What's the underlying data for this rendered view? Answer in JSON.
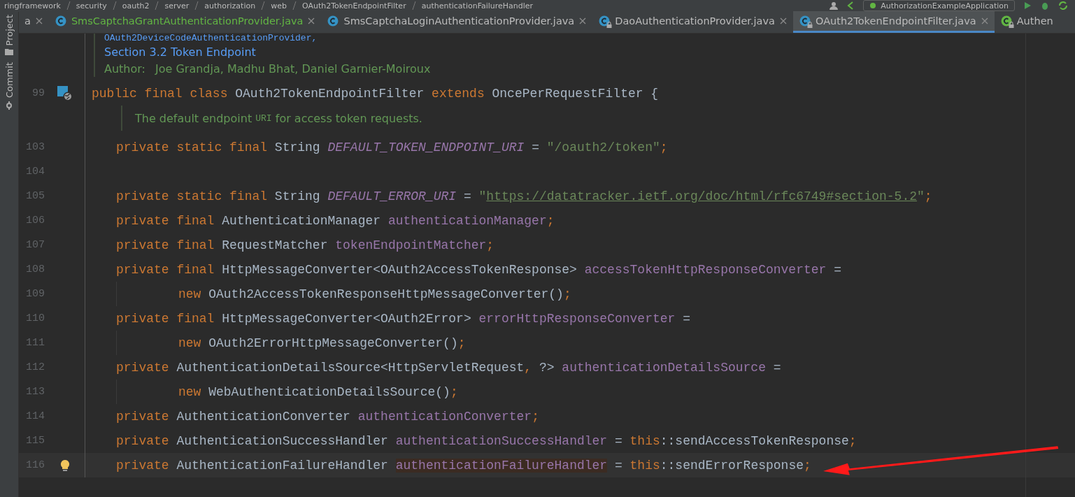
{
  "breadcrumb": [
    "ringframework",
    "security",
    "oauth2",
    "server",
    "authorization",
    "web",
    "OAuth2TokenEndpointFilter",
    "authenticationFailureHandler"
  ],
  "run_config": "AuthorizationExampleApplication",
  "tool_strip": [
    {
      "label": "Project"
    },
    {
      "label": "Commit"
    }
  ],
  "tabs": [
    {
      "kind": "partial",
      "label": "a",
      "modified": false,
      "locked": false,
      "selected": false
    },
    {
      "kind": "class",
      "label": "SmsCaptchaGrantAuthenticationProvider.java",
      "modified": true,
      "locked": false,
      "selected": false
    },
    {
      "kind": "class",
      "label": "SmsCaptchaLoginAuthenticationProvider.java",
      "modified": false,
      "locked": false,
      "selected": false
    },
    {
      "kind": "class",
      "label": "DaoAuthenticationProvider.java",
      "modified": false,
      "locked": true,
      "selected": false
    },
    {
      "kind": "class",
      "label": "OAuth2TokenEndpointFilter.java",
      "modified": false,
      "locked": true,
      "selected": true
    },
    {
      "kind": "interface",
      "label": "Authen",
      "modified": false,
      "locked": true,
      "selected": false
    }
  ],
  "editor": {
    "header_doc": [
      [
        {
          "kind": "code",
          "text": "OAuth2DeviceCodeAuthenticationProvider,"
        }
      ],
      [
        {
          "kind": "link",
          "text": "Section 3.2 Token Endpoint"
        }
      ],
      [
        {
          "kind": "label",
          "text": "Author:"
        },
        {
          "kind": "text",
          "text": "Joe Grandja, Madhu Bhat, Daniel Garnier-Moiroux"
        }
      ]
    ],
    "class_line": {
      "number": "99",
      "tokens": [
        {
          "kind": "kw",
          "text": "public final class "
        },
        {
          "kind": "type",
          "text": "OAuth2TokenEndpointFilter "
        },
        {
          "kind": "kw",
          "text": "extends "
        },
        {
          "kind": "type",
          "text": "OncePerRequestFilter {"
        }
      ]
    },
    "member_doc": [
      [
        {
          "kind": "text",
          "text": "The default endpoint "
        },
        {
          "kind": "code",
          "text": "URI"
        },
        {
          "kind": "text",
          "text": " for access token requests."
        }
      ]
    ],
    "members": [
      {
        "number": "103",
        "current": false,
        "continuation": false,
        "tokens": [
          {
            "kind": "kw",
            "text": "private static final "
          },
          {
            "kind": "type",
            "text": "String "
          },
          {
            "kind": "static",
            "text": "DEFAULT_TOKEN_ENDPOINT_URI"
          },
          {
            "kind": "type",
            "text": " = "
          },
          {
            "kind": "str",
            "text": "\"/oauth2/token\""
          },
          {
            "kind": "kw",
            "text": ";"
          }
        ]
      },
      {
        "number": "104",
        "current": false,
        "continuation": false
      },
      {
        "number": "105",
        "current": false,
        "continuation": false,
        "tokens": [
          {
            "kind": "kw",
            "text": "private static final "
          },
          {
            "kind": "type",
            "text": "String "
          },
          {
            "kind": "static",
            "text": "DEFAULT_ERROR_URI"
          },
          {
            "kind": "type",
            "text": " = "
          },
          {
            "kind": "str",
            "text": "\""
          },
          {
            "kind": "url",
            "text": "https://datatracker.ietf.org/doc/html/rfc6749#section-5.2"
          },
          {
            "kind": "str",
            "text": "\""
          },
          {
            "kind": "kw",
            "text": ";"
          }
        ]
      },
      {
        "number": "106",
        "current": false,
        "continuation": false,
        "tokens": [
          {
            "kind": "kw",
            "text": "private final "
          },
          {
            "kind": "type",
            "text": "AuthenticationManager "
          },
          {
            "kind": "field",
            "text": "authenticationManager"
          },
          {
            "kind": "kw",
            "text": ";"
          }
        ]
      },
      {
        "number": "107",
        "current": false,
        "continuation": false,
        "tokens": [
          {
            "kind": "kw",
            "text": "private final "
          },
          {
            "kind": "type",
            "text": "RequestMatcher "
          },
          {
            "kind": "field",
            "text": "tokenEndpointMatcher"
          },
          {
            "kind": "kw",
            "text": ";"
          }
        ]
      },
      {
        "number": "108",
        "current": false,
        "continuation": false,
        "tokens": [
          {
            "kind": "kw",
            "text": "private final "
          },
          {
            "kind": "type",
            "text": "HttpMessageConverter<OAuth2AccessTokenResponse> "
          },
          {
            "kind": "field",
            "text": "accessTokenHttpResponseConverter"
          },
          {
            "kind": "type",
            "text": " ="
          }
        ]
      },
      {
        "number": "109",
        "current": false,
        "continuation": true,
        "tokens": [
          {
            "kind": "kw",
            "text": "new "
          },
          {
            "kind": "type",
            "text": "OAuth2AccessTokenResponseHttpMessageConverter()"
          },
          {
            "kind": "kw",
            "text": ";"
          }
        ]
      },
      {
        "number": "110",
        "current": false,
        "continuation": false,
        "tokens": [
          {
            "kind": "kw",
            "text": "private final "
          },
          {
            "kind": "type",
            "text": "HttpMessageConverter<OAuth2Error> "
          },
          {
            "kind": "field",
            "text": "errorHttpResponseConverter"
          },
          {
            "kind": "type",
            "text": " ="
          }
        ]
      },
      {
        "number": "111",
        "current": false,
        "continuation": true,
        "tokens": [
          {
            "kind": "kw",
            "text": "new "
          },
          {
            "kind": "type",
            "text": "OAuth2ErrorHttpMessageConverter()"
          },
          {
            "kind": "kw",
            "text": ";"
          }
        ]
      },
      {
        "number": "112",
        "current": false,
        "continuation": false,
        "tokens": [
          {
            "kind": "kw",
            "text": "private "
          },
          {
            "kind": "type",
            "text": "AuthenticationDetailsSource<HttpServletRequest"
          },
          {
            "kind": "kw",
            "text": ", "
          },
          {
            "kind": "type",
            "text": "?> "
          },
          {
            "kind": "field",
            "text": "authenticationDetailsSource"
          },
          {
            "kind": "type",
            "text": " ="
          }
        ]
      },
      {
        "number": "113",
        "current": false,
        "continuation": true,
        "tokens": [
          {
            "kind": "kw",
            "text": "new "
          },
          {
            "kind": "type",
            "text": "WebAuthenticationDetailsSource()"
          },
          {
            "kind": "kw",
            "text": ";"
          }
        ]
      },
      {
        "number": "114",
        "current": false,
        "continuation": false,
        "tokens": [
          {
            "kind": "kw",
            "text": "private "
          },
          {
            "kind": "type",
            "text": "AuthenticationConverter "
          },
          {
            "kind": "field",
            "text": "authenticationConverter"
          },
          {
            "kind": "kw",
            "text": ";"
          }
        ]
      },
      {
        "number": "115",
        "current": false,
        "continuation": false,
        "tokens": [
          {
            "kind": "kw",
            "text": "private "
          },
          {
            "kind": "type",
            "text": "AuthenticationSuccessHandler "
          },
          {
            "kind": "field",
            "text": "authenticationSuccessHandler"
          },
          {
            "kind": "type",
            "text": " = "
          },
          {
            "kind": "kw",
            "text": "this"
          },
          {
            "kind": "type",
            "text": "::sendAccessTokenResponse"
          },
          {
            "kind": "kw",
            "text": ";"
          }
        ]
      },
      {
        "number": "116",
        "current": true,
        "continuation": false,
        "intention_bulb": true,
        "tokens": [
          {
            "kind": "kw",
            "text": "private "
          },
          {
            "kind": "type",
            "text": "AuthenticationFailureHandler "
          },
          {
            "kind": "hl",
            "text": "authenticationFailureHandler"
          },
          {
            "kind": "type",
            "text": " = "
          },
          {
            "kind": "kw",
            "text": "this"
          },
          {
            "kind": "type",
            "text": "::sendErrorResponse"
          },
          {
            "kind": "kw",
            "text": ";"
          }
        ]
      }
    ]
  }
}
